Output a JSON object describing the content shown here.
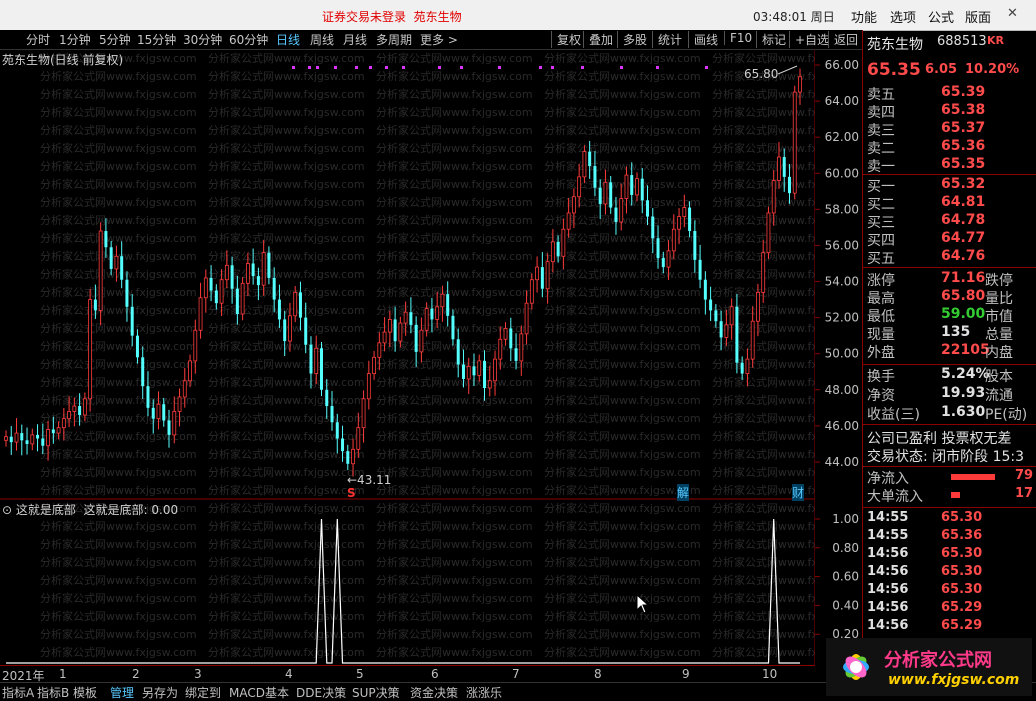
{
  "topbar": {
    "notice": "证券交易未登录",
    "stock_title": "苑东生物",
    "clock": "03:48:01 周日",
    "menu": [
      "功能",
      "选项",
      "公式",
      "版面"
    ],
    "window_controls": [
      "minimize-icon",
      "maximize-icon",
      "close-icon"
    ]
  },
  "toolbar": {
    "periods": [
      "分时",
      "1分钟",
      "5分钟",
      "15分钟",
      "30分钟",
      "60分钟",
      "日线",
      "周线",
      "月线",
      "多周期",
      "更多 >"
    ],
    "active_period": "日线",
    "tools": [
      "复权",
      "叠加",
      "多股",
      "统计",
      "画线",
      "F10",
      "标记",
      "+自选",
      "返回"
    ]
  },
  "main": {
    "title": "苑东生物(日线 前复权)",
    "high_label": "65.80",
    "low_label": "←43.11",
    "markers": {
      "s": "S",
      "jie": "解",
      "cai": "财"
    },
    "watermark": "分析家公式网www.fxjgsw.com"
  },
  "sub": {
    "title": "这就是底部",
    "indicator_label": "这就是底部: 0.00"
  },
  "chart_data": [
    {
      "type": "candlestick",
      "title": "苑东生物(日线 前复权)",
      "y_ticks": [
        "66.00",
        "64.00",
        "62.00",
        "60.00",
        "58.00",
        "56.00",
        "54.00",
        "52.00",
        "50.00",
        "48.00",
        "46.00",
        "44.00"
      ],
      "ylim": [
        43.0,
        66.5
      ],
      "x_ticks": [
        "2021年",
        "1",
        "2",
        "3",
        "4",
        "5",
        "6",
        "7",
        "8",
        "9",
        "10"
      ],
      "annotations": {
        "max": 65.8,
        "min": 43.11
      },
      "close_series": [
        45.4,
        45.1,
        45.6,
        45.2,
        45.0,
        45.5,
        45.3,
        44.9,
        45.8,
        45.6,
        45.9,
        46.4,
        46.8,
        47.1,
        46.6,
        47.5,
        53.0,
        52.4,
        56.8,
        55.9,
        54.7,
        55.4,
        54.1,
        52.6,
        51.0,
        49.8,
        48.2,
        47.0,
        46.4,
        47.2,
        46.3,
        45.5,
        46.8,
        47.6,
        48.5,
        49.6,
        51.3,
        53.1,
        54.2,
        53.5,
        52.8,
        54.1,
        54.9,
        53.6,
        52.2,
        53.9,
        55.0,
        54.3,
        53.8,
        55.6,
        54.2,
        53.0,
        51.9,
        50.7,
        52.1,
        53.4,
        52.0,
        50.5,
        48.9,
        50.3,
        48.0,
        47.1,
        46.2,
        45.3,
        44.6,
        43.9,
        44.7,
        45.9,
        47.5,
        48.9,
        49.8,
        50.6,
        51.2,
        51.9,
        50.7,
        51.7,
        52.3,
        51.6,
        50.1,
        51.3,
        52.5,
        51.9,
        52.6,
        53.3,
        52.1,
        50.8,
        49.4,
        48.6,
        49.3,
        48.8,
        49.6,
        48.1,
        48.5,
        49.7,
        50.8,
        51.4,
        50.3,
        49.6,
        51.1,
        52.8,
        54.1,
        54.8,
        53.6,
        55.1,
        56.2,
        55.4,
        56.9,
        57.8,
        58.7,
        59.8,
        61.2,
        60.4,
        59.2,
        58.3,
        59.5,
        58.1,
        57.3,
        58.6,
        59.9,
        58.8,
        59.7,
        58.5,
        57.6,
        56.4,
        55.3,
        54.8,
        55.7,
        56.9,
        57.6,
        58.1,
        56.8,
        55.2,
        54.1,
        53.0,
        52.4,
        51.8,
        50.9,
        51.6,
        52.6,
        49.5,
        48.9,
        49.7,
        51.8,
        53.4,
        55.6,
        57.8,
        59.6,
        60.9,
        59.8,
        58.9,
        64.5,
        65.35
      ]
    },
    {
      "type": "line",
      "title": "这就是底部",
      "y_ticks": [
        "1.00",
        "0.80",
        "0.60",
        "0.40",
        "0.20"
      ],
      "ylim": [
        0,
        1.0
      ],
      "spike_indices": [
        60,
        63,
        146
      ],
      "series": [
        {
          "name": "这就是底部",
          "value_now": 0.0
        }
      ]
    }
  ],
  "panel": {
    "name": "苑东生物",
    "code": "688513",
    "kr": "KR",
    "price": "65.35",
    "change": "6.05",
    "pct": "10.20%",
    "asks": [
      {
        "label": "卖五",
        "price": "65.39"
      },
      {
        "label": "卖四",
        "price": "65.38"
      },
      {
        "label": "卖三",
        "price": "65.37"
      },
      {
        "label": "卖二",
        "price": "65.36"
      },
      {
        "label": "卖一",
        "price": "65.35"
      }
    ],
    "bids": [
      {
        "label": "买一",
        "price": "65.32"
      },
      {
        "label": "买二",
        "price": "64.81"
      },
      {
        "label": "买三",
        "price": "64.78"
      },
      {
        "label": "买四",
        "price": "64.77"
      },
      {
        "label": "买五",
        "price": "64.76"
      }
    ],
    "stats": [
      {
        "label": "涨停",
        "value": "71.16",
        "label2": "跌停",
        "color": "red"
      },
      {
        "label": "最高",
        "value": "65.80",
        "label2": "量比",
        "color": "red"
      },
      {
        "label": "最低",
        "value": "59.00",
        "label2": "市值",
        "color": "green"
      },
      {
        "label": "现量",
        "value": "135",
        "label2": "总量",
        "color": "wht"
      },
      {
        "label": "外盘",
        "value": "22105",
        "label2": "内盘",
        "color": "red"
      }
    ],
    "stats2": [
      {
        "label": "换手",
        "value": "5.24%",
        "label2": "股本"
      },
      {
        "label": "净资",
        "value": "19.93",
        "label2": "流通"
      },
      {
        "label": "收益(三)",
        "value": "1.630",
        "label2": "PE(动)"
      }
    ],
    "company_note": "公司已盈利 投票权无差",
    "trade_status": "交易状态: 闭市阶段 15:3",
    "net_inflow_label": "净流入",
    "net_inflow_value": "79",
    "big_inflow_label": "大单流入",
    "big_inflow_value": "17",
    "ticks": [
      {
        "time": "14:55",
        "price": "65.30"
      },
      {
        "time": "14:55",
        "price": "65.36"
      },
      {
        "time": "14:56",
        "price": "65.30"
      },
      {
        "time": "14:56",
        "price": "65.30"
      },
      {
        "time": "14:56",
        "price": "65.30"
      },
      {
        "time": "14:56",
        "price": "65.29"
      },
      {
        "time": "14:56",
        "price": "65.29"
      }
    ]
  },
  "bottom_tabs": [
    "指标A",
    "指标B",
    "模板",
    "管理",
    "另存为",
    "绑定到",
    "MACD基本",
    "DDE决策",
    "SUP决策",
    "资金决策",
    "涨涨乐"
  ],
  "active_bottom_tab": "管理",
  "logo": {
    "text": "分析家公式网",
    "url_text": "www.fxjgsw.com"
  }
}
